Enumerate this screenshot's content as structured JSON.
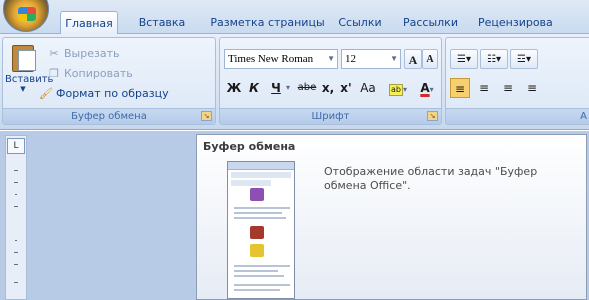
{
  "tabs": [
    {
      "label": "Главная",
      "active": true
    },
    {
      "label": "Вставка",
      "active": false
    },
    {
      "label": "Разметка страницы",
      "active": false
    },
    {
      "label": "Ссылки",
      "active": false
    },
    {
      "label": "Рассылки",
      "active": false
    },
    {
      "label": "Рецензирова",
      "active": false
    }
  ],
  "clipboard_group": {
    "label": "Буфер обмена",
    "paste_label": "Вставить",
    "cut_label": "Вырезать",
    "copy_label": "Копировать",
    "format_painter_label": "Формат по образцу"
  },
  "font_group": {
    "label": "Шрифт",
    "font_name": "Times New Roman",
    "font_size": "12",
    "bold": "Ж",
    "italic": "К",
    "underline": "Ч",
    "strikethrough": "abe",
    "subscript": "x,",
    "superscript": "x'",
    "change_case": "Aa",
    "grow_font": "A",
    "shrink_font": "A"
  },
  "paragraph_group_partial_label": "А",
  "tooltip": {
    "title": "Буфер обмена",
    "text": "Отображение области задач \"Буфер обмена Office\"."
  },
  "ruler_button": "L"
}
